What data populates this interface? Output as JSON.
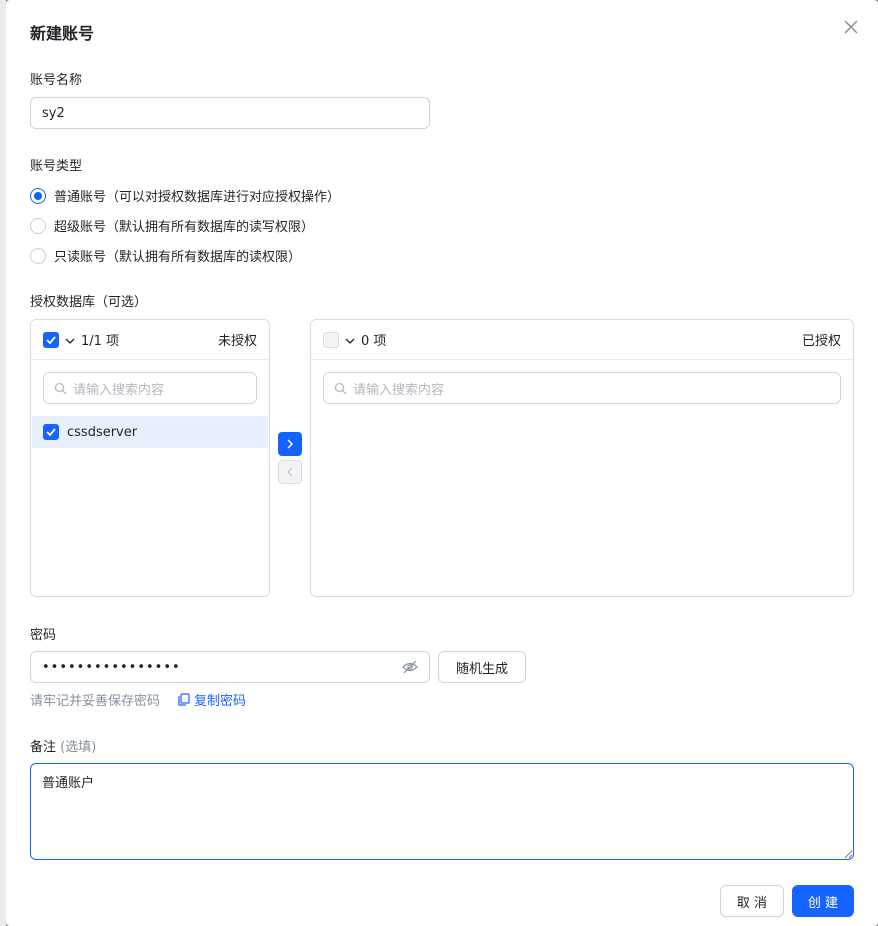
{
  "dialog": {
    "title": "新建账号"
  },
  "account_name": {
    "label": "账号名称",
    "value": "sy2"
  },
  "account_type": {
    "label": "账号类型",
    "options": [
      {
        "label": "普通账号（可以对授权数据库进行对应授权操作）",
        "selected": true
      },
      {
        "label": "超级账号（默认拥有所有数据库的读写权限）",
        "selected": false
      },
      {
        "label": "只读账号（默认拥有所有数据库的读权限）",
        "selected": false
      }
    ]
  },
  "databases": {
    "label": "授权数据库（可选）",
    "left": {
      "count": "1/1 项",
      "title": "未授权",
      "search_placeholder": "请输入搜索内容",
      "items": [
        {
          "label": "cssdserver",
          "checked": true
        }
      ]
    },
    "right": {
      "count": "0 项",
      "title": "已授权",
      "search_placeholder": "请输入搜索内容",
      "items": []
    }
  },
  "password": {
    "label": "密码",
    "masked": "••••••••••••••••",
    "generate_label": "随机生成",
    "hint": "请牢记并妥善保存密码",
    "copy_label": "复制密码"
  },
  "remark": {
    "label": "备注",
    "optional": "(选填)",
    "value": "普通账户"
  },
  "footer": {
    "cancel_label": "取 消",
    "create_label": "创 建"
  },
  "colors": {
    "primary": "#1664ff",
    "border": "#d0d3d9",
    "hint": "#86909c"
  }
}
